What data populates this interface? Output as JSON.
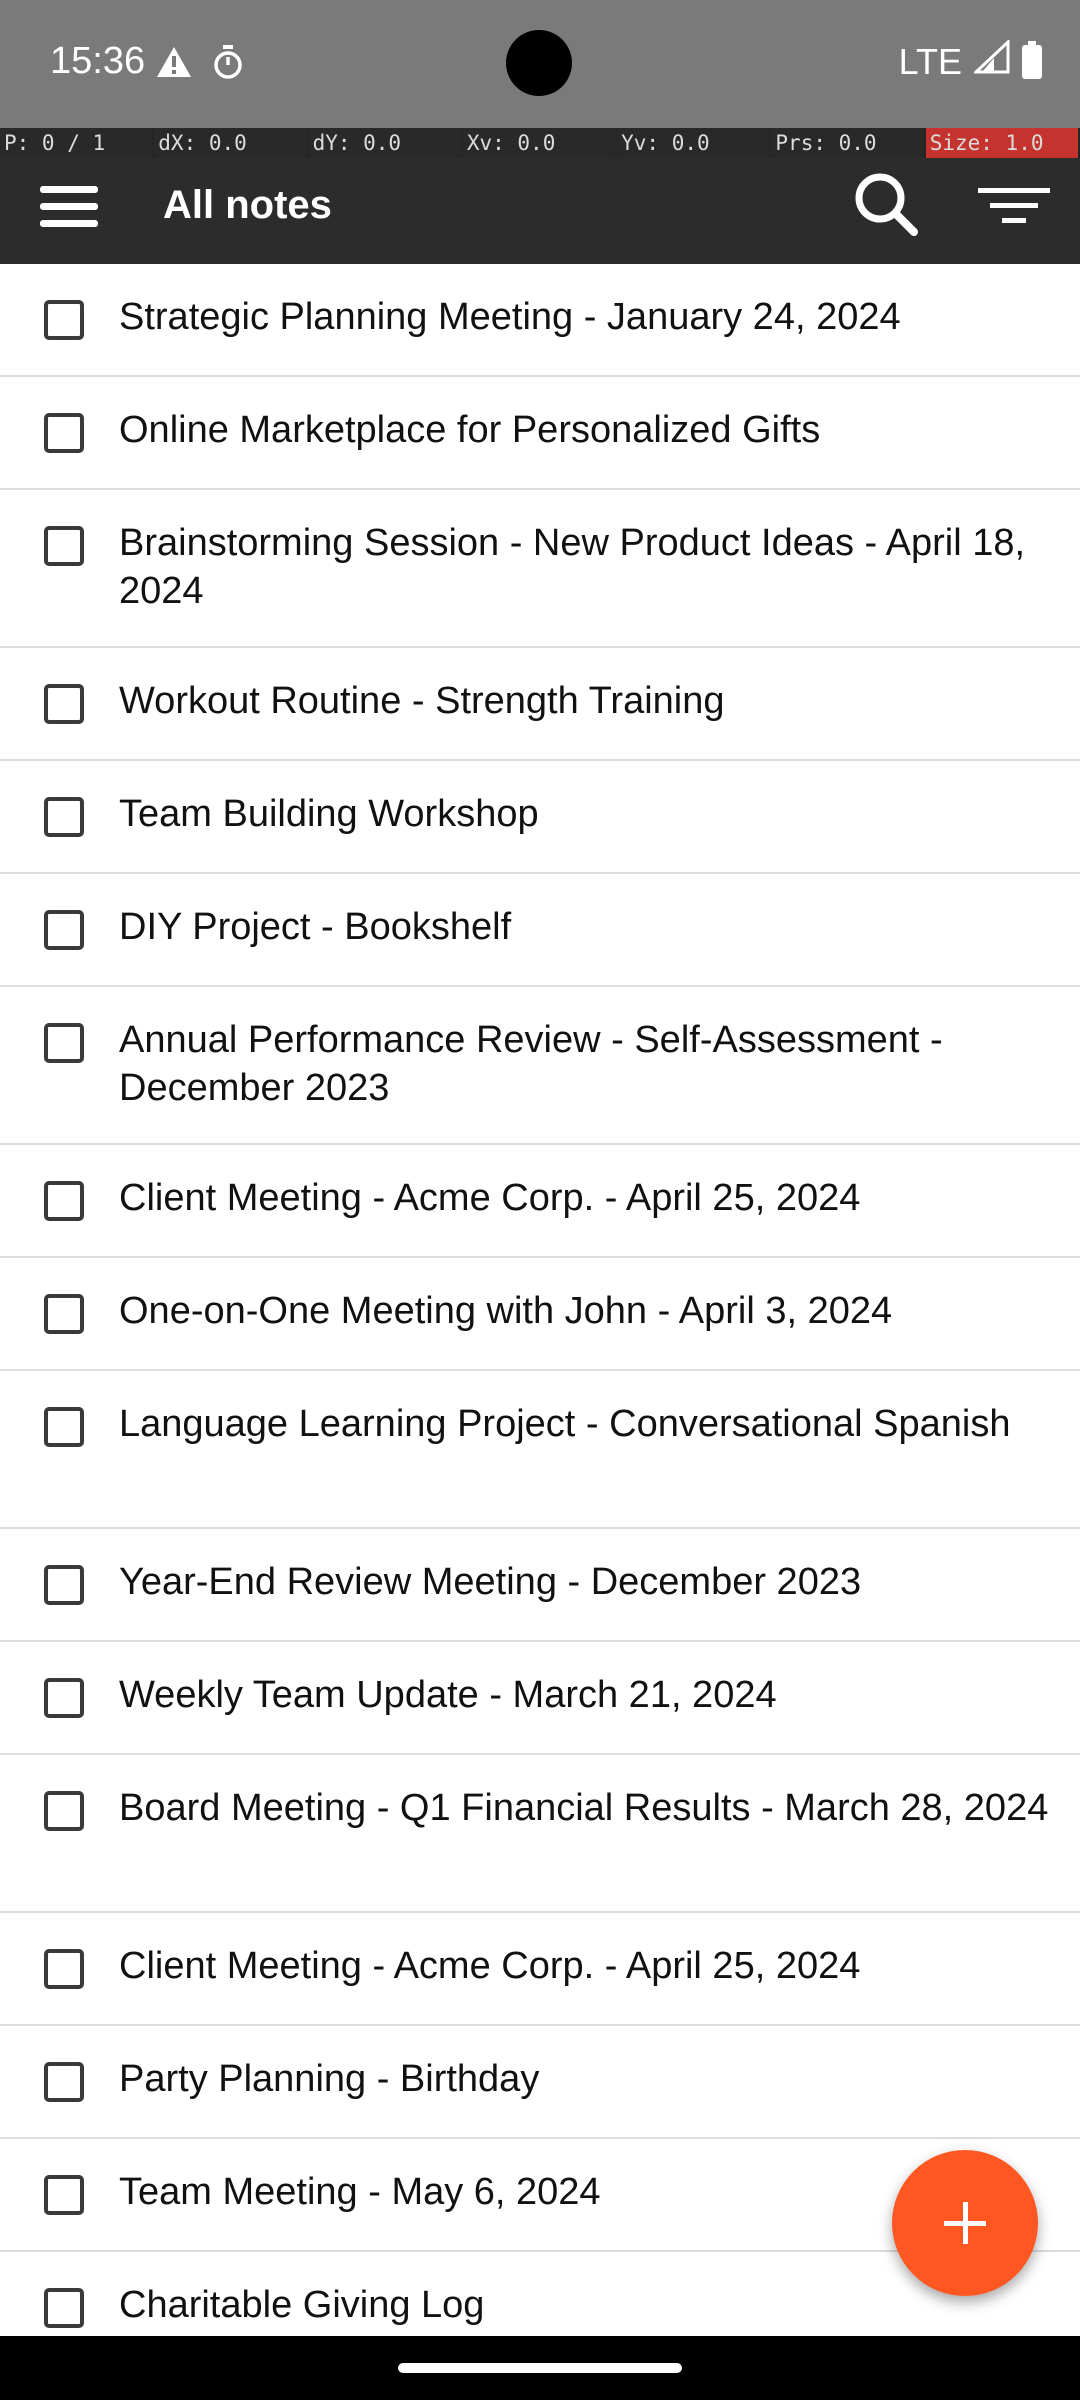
{
  "status_bar": {
    "time": "15:36",
    "network": "LTE",
    "icons": [
      "alert-triangle-icon",
      "stopwatch-icon",
      "signal-icon",
      "battery-icon"
    ]
  },
  "debug_overlay": {
    "cells": [
      "P: 0 / 1",
      "dX: 0.0",
      "dY: 0.0",
      "Xv: 0.0",
      "Yv: 0.0",
      "Prs: 0.0",
      "Size: 1.0"
    ]
  },
  "app_bar": {
    "title": "All notes",
    "icons": [
      "menu-icon",
      "search-icon",
      "filter-icon"
    ]
  },
  "notes": [
    {
      "title": "Strategic Planning Meeting - January 24, 2024"
    },
    {
      "title": "Online Marketplace for Personalized Gifts"
    },
    {
      "title": "Brainstorming Session - New Product Ideas - April 18, 2024"
    },
    {
      "title": "Workout Routine - Strength Training"
    },
    {
      "title": "Team Building Workshop"
    },
    {
      "title": "DIY Project - Bookshelf"
    },
    {
      "title": "Annual Performance Review - Self-Assessment - December 2023"
    },
    {
      "title": "Client Meeting - Acme Corp. - April 25, 2024"
    },
    {
      "title": "One-on-One Meeting with John - April 3, 2024"
    },
    {
      "title": "Language Learning Project - Conversational Spanish"
    },
    {
      "title": "Year-End Review Meeting - December 2023"
    },
    {
      "title": "Weekly Team Update - March 21, 2024"
    },
    {
      "title": "Board Meeting - Q1 Financial Results - March 28, 2024"
    },
    {
      "title": "Client Meeting - Acme Corp. - April 25, 2024"
    },
    {
      "title": "Party Planning - Birthday"
    },
    {
      "title": "Team Meeting - May 6, 2024"
    },
    {
      "title": "Charitable Giving Log"
    }
  ],
  "fab": {
    "icon": "plus-icon"
  },
  "colors": {
    "app_bar": "#2c2c2c",
    "accent": "#ff5722",
    "status_bar": "#7a7a7a"
  }
}
